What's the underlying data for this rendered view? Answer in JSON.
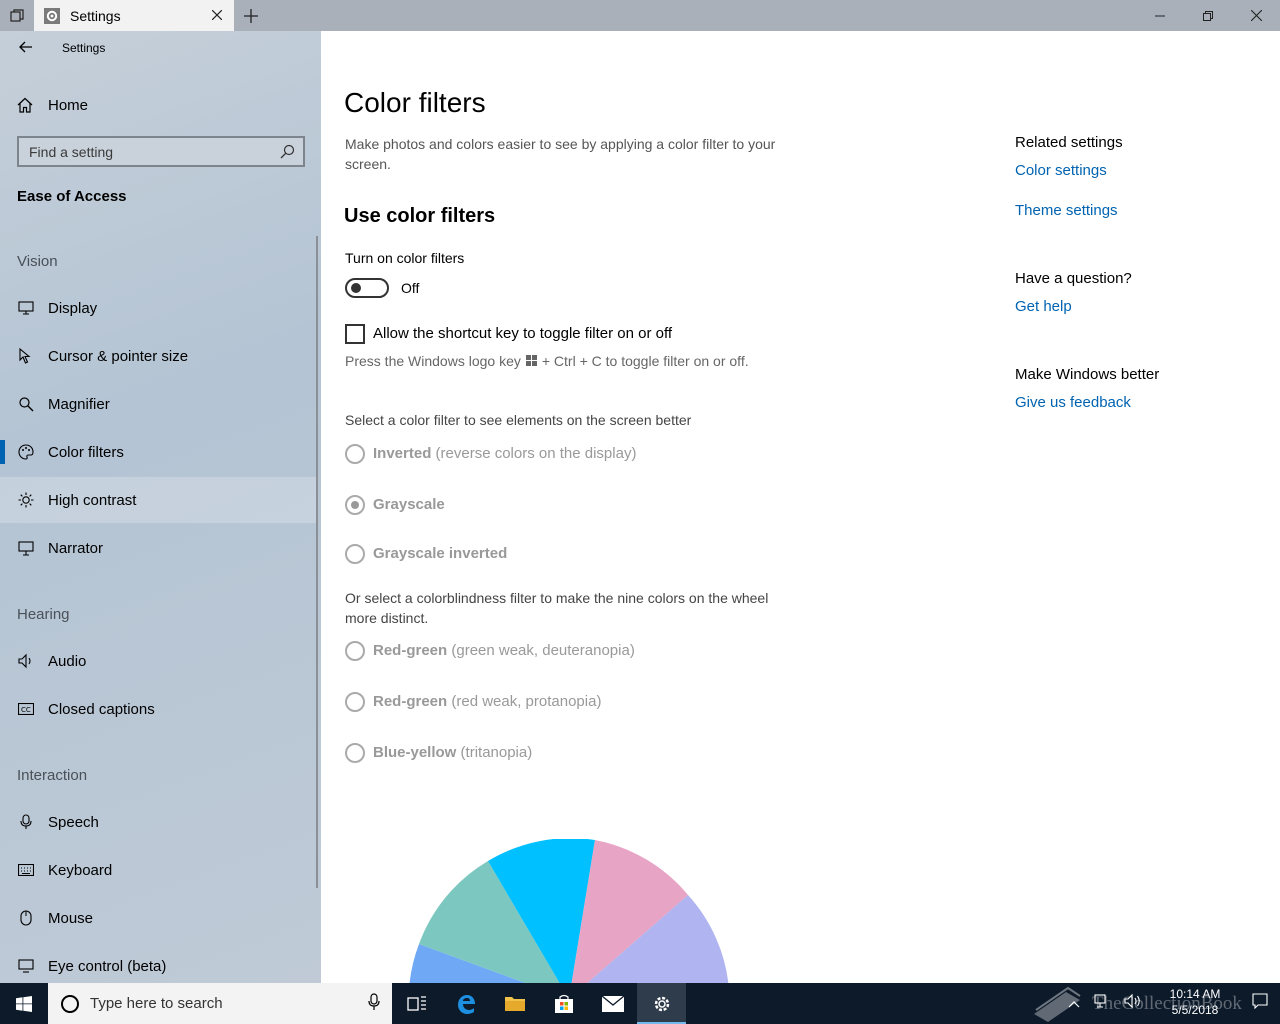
{
  "window": {
    "tab_title": "Settings",
    "app_title": "Settings"
  },
  "sidebar": {
    "home_label": "Home",
    "search_placeholder": "Find a setting",
    "section_title": "Ease of Access",
    "groups": {
      "vision": "Vision",
      "hearing": "Hearing",
      "interaction": "Interaction"
    },
    "items": [
      {
        "label": "Display",
        "icon": "monitor-icon"
      },
      {
        "label": "Cursor & pointer size",
        "icon": "cursor-icon"
      },
      {
        "label": "Magnifier",
        "icon": "magnifier-icon"
      },
      {
        "label": "Color filters",
        "icon": "palette-icon",
        "selected": true
      },
      {
        "label": "High contrast",
        "icon": "sun-icon"
      },
      {
        "label": "Narrator",
        "icon": "narrator-icon"
      },
      {
        "label": "Audio",
        "icon": "speaker-icon"
      },
      {
        "label": "Closed captions",
        "icon": "cc-icon"
      },
      {
        "label": "Speech",
        "icon": "microphone-icon"
      },
      {
        "label": "Keyboard",
        "icon": "keyboard-icon"
      },
      {
        "label": "Mouse",
        "icon": "mouse-icon"
      },
      {
        "label": "Eye control (beta)",
        "icon": "eye-icon"
      }
    ]
  },
  "main": {
    "title": "Color filters",
    "description": "Make photos and colors easier to see by applying a color filter to your screen.",
    "section_heading": "Use color filters",
    "toggle_label": "Turn on color filters",
    "toggle_state": "Off",
    "shortcut_checkbox_label": "Allow the shortcut key to toggle filter on or off",
    "shortcut_hint_before": "Press the Windows logo key",
    "shortcut_hint_after": "+ Ctrl + C to toggle filter on or off.",
    "filter_prompt": "Select a color filter to see elements on the screen better",
    "filters": [
      {
        "name": "Inverted",
        "detail": "(reverse colors on the display)",
        "selected": false
      },
      {
        "name": "Grayscale",
        "detail": "",
        "selected": true
      },
      {
        "name": "Grayscale inverted",
        "detail": "",
        "selected": false
      }
    ],
    "colorblind_prompt": "Or select a colorblindness filter to make the nine colors on the wheel more distinct.",
    "colorblind_filters": [
      {
        "name": "Red-green",
        "detail": "(green weak, deuteranopia)",
        "selected": false
      },
      {
        "name": "Red-green",
        "detail": "(red weak, protanopia)",
        "selected": false
      },
      {
        "name": "Blue-yellow",
        "detail": "(tritanopia)",
        "selected": false
      }
    ],
    "wheel_colors": [
      "#6fa8f5",
      "#7cc8c0",
      "#00c0ff",
      "#e8a4c4",
      "#b0b4f0"
    ]
  },
  "related": {
    "heading": "Related settings",
    "links": [
      "Color settings",
      "Theme settings"
    ],
    "question_heading": "Have a question?",
    "help_link": "Get help",
    "better_heading": "Make Windows better",
    "feedback_link": "Give us feedback"
  },
  "taskbar": {
    "search_placeholder": "Type here to search",
    "watermark": "TheCollectionBook",
    "time": "10:14 AM",
    "date": "5/5/2018"
  },
  "colors": {
    "accent": "#0063b1",
    "taskbar": "#0c1a2a"
  }
}
